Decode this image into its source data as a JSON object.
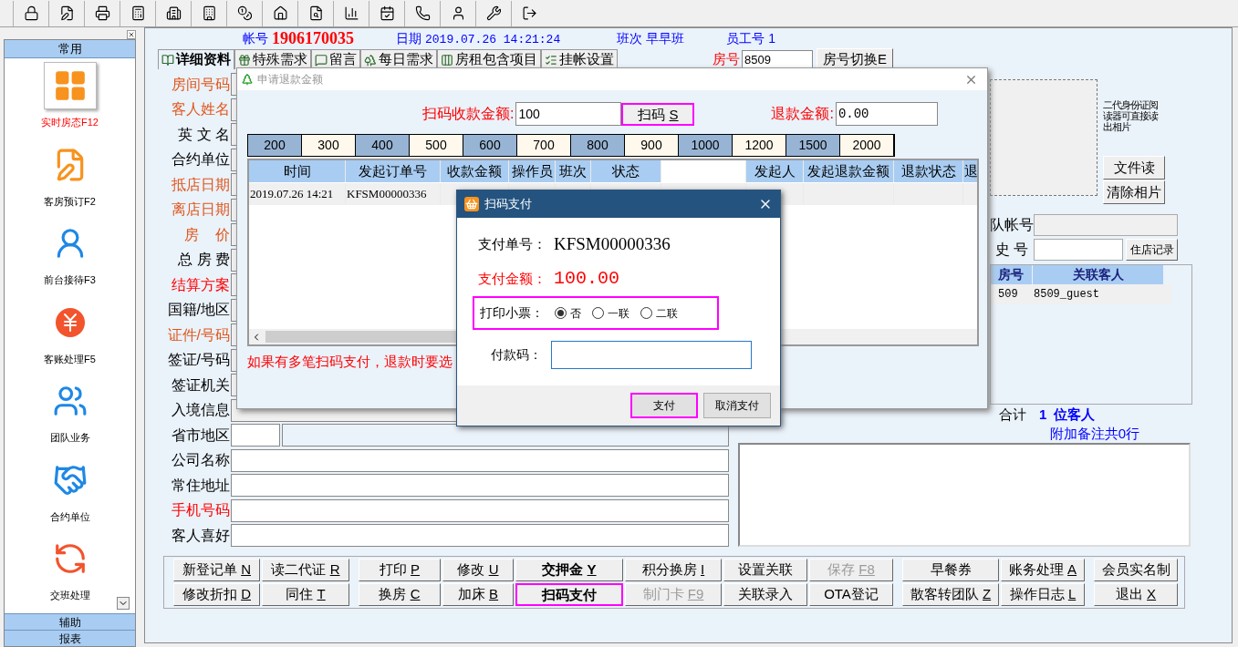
{
  "sidebar": {
    "header": "常用",
    "items": [
      {
        "label": "实时房态F12",
        "selected": true
      },
      {
        "label": "客房预订F2",
        "selected": false
      },
      {
        "label": "前台接待F3",
        "selected": false
      },
      {
        "label": "客账处理F5",
        "selected": false
      },
      {
        "label": "团队业务",
        "selected": false
      },
      {
        "label": "合约单位",
        "selected": false
      },
      {
        "label": "交班处理",
        "selected": false
      }
    ],
    "footer": [
      "辅助",
      "报表"
    ]
  },
  "header": {
    "account_label": "帐号",
    "account": "1906170035",
    "date_label": "日期",
    "date": "2019.07.26 14:21:24",
    "shift_label": "班次",
    "shift": "早早班",
    "staff_label": "员工号",
    "staff": "1"
  },
  "tabs": [
    {
      "label": "详细资料",
      "selected": true
    },
    {
      "label": "特殊需求",
      "selected": false
    },
    {
      "label": "留言",
      "selected": false
    },
    {
      "label": "每日需求",
      "selected": false
    },
    {
      "label": "房租包含项目",
      "selected": false
    },
    {
      "label": "挂帐设置",
      "selected": false
    }
  ],
  "room": {
    "label": "房号",
    "value": "8509",
    "switch_button": "房号切换E"
  },
  "form": [
    {
      "label": "房间号码",
      "color": "#e0561b"
    },
    {
      "label": "客人姓名",
      "color": "#e0561b"
    },
    {
      "label": "英 文 名",
      "color": "#000000"
    },
    {
      "label": "合约单位",
      "color": "#000000"
    },
    {
      "label": "抵店日期",
      "color": "#e0561b"
    },
    {
      "label": "离店日期",
      "color": "#e0561b"
    },
    {
      "label": "房    价",
      "color": "#e0561b"
    },
    {
      "label": "总 房 费",
      "color": "#000000"
    },
    {
      "label": "结算方案",
      "color": "#ff0000"
    },
    {
      "label": "国籍/地区",
      "color": "#000000"
    },
    {
      "label": "证件/号码",
      "color": "#e0561b"
    },
    {
      "label": "签证/号码",
      "color": "#000000"
    },
    {
      "label": "签证机关",
      "color": "#000000"
    },
    {
      "label": "入境信息",
      "color": "#000000"
    },
    {
      "label": "省市地区",
      "color": "#000000"
    },
    {
      "label": "公司名称",
      "color": "#000000"
    },
    {
      "label": "常住地址",
      "color": "#000000"
    },
    {
      "label": "手机号码",
      "color": "#ff0000"
    },
    {
      "label": "客人喜好",
      "color": "#000000"
    }
  ],
  "photo": {
    "hint": "二代身份证阅读器可直接读出相片",
    "buttons": [
      "文件读",
      "清除相片"
    ]
  },
  "team_account_label": "队帐号",
  "history_label": "史 号",
  "history_button": "住店记录",
  "linked": {
    "columns": [
      "房号",
      "关联客人"
    ],
    "rows": [
      [
        "509",
        "8509_guest"
      ]
    ]
  },
  "total": {
    "label": "合计",
    "count": "1",
    "unit": "位客人"
  },
  "extra_notes": "附加备注共0行",
  "actions": [
    [
      [
        {
          "label": "新登记单",
          "key": "N"
        },
        {
          "label": "修改折扣",
          "key": "D"
        }
      ],
      [
        {
          "label": "读二代证",
          "key": "R"
        },
        {
          "label": "同住",
          "key": "T"
        }
      ]
    ],
    [
      [
        {
          "label": "打印",
          "key": "P"
        },
        {
          "label": "换房",
          "key": "C"
        }
      ],
      [
        {
          "label": "修改",
          "key": "U"
        },
        {
          "label": "加床",
          "key": "B"
        }
      ],
      [
        {
          "label": "交押金",
          "key": "Y",
          "bold": true
        },
        {
          "label": "扫码支付",
          "bold": true,
          "highlighted": true
        }
      ],
      [
        {
          "label": "积分换房",
          "key": "I"
        },
        {
          "label": "制门卡",
          "key": "F9",
          "disabled": true
        }
      ],
      [
        {
          "label": "设置关联"
        },
        {
          "label": "关联录入"
        }
      ],
      [
        {
          "label": "保存",
          "key": "F8",
          "disabled": true
        },
        {
          "label": "OTA登记"
        }
      ]
    ],
    [
      [
        {
          "label": "早餐券"
        },
        {
          "label": "散客转团队",
          "key": "Z"
        }
      ],
      [
        {
          "label": "账务处理",
          "key": "A"
        },
        {
          "label": "操作日志",
          "key": "L"
        }
      ]
    ],
    [
      [
        {
          "label": "会员实名制"
        },
        {
          "label": "退出",
          "key": "X"
        }
      ]
    ]
  ],
  "refund_dialog": {
    "title": "申请退款金额",
    "scan_amount_label": "扫码收款金额:",
    "scan_amount": "100",
    "scan_button": {
      "label": "扫码",
      "key": "S",
      "highlighted": true
    },
    "refund_label": "退款金额:",
    "refund_amount": "0.00",
    "amounts": [
      "200",
      "300",
      "400",
      "500",
      "600",
      "700",
      "800",
      "900",
      "1000",
      "1200",
      "1500",
      "2000"
    ],
    "columns": [
      {
        "kind": "heading",
        "label": "时间"
      },
      {
        "kind": "heading",
        "label": "发起订单号"
      },
      {
        "kind": "heading",
        "label": "收款金额"
      },
      {
        "kind": "heading",
        "label": "操作员"
      },
      {
        "kind": "heading",
        "label": "班次"
      },
      {
        "kind": "heading",
        "label": "状态"
      },
      {
        "kind": "blank"
      },
      {
        "kind": "heading",
        "label": "发起人"
      },
      {
        "kind": "heading",
        "label": "发起退款金额"
      },
      {
        "kind": "heading",
        "label": "退款状态"
      },
      {
        "kind": "heading",
        "label": "退"
      }
    ],
    "rows": [
      [
        "2019.07.26 14:21",
        "KFSM00000336"
      ]
    ],
    "note": "如果有多笔扫码支付，退款时要选"
  },
  "pay_dialog": {
    "title": "扫码支付",
    "order_label": "支付单号：",
    "order": "KFSM00000336",
    "amount_label": "支付金额：",
    "amount": "100.00",
    "print_label": "打印小票：",
    "print_highlighted": true,
    "print_options": [
      {
        "label": "否",
        "selected": true
      },
      {
        "label": "一联",
        "selected": false
      },
      {
        "label": "二联",
        "selected": false
      }
    ],
    "code_label": "付款码：",
    "buttons": [
      {
        "label": "支付",
        "highlighted": true
      },
      {
        "label": "取消支付",
        "highlighted": false
      }
    ]
  }
}
